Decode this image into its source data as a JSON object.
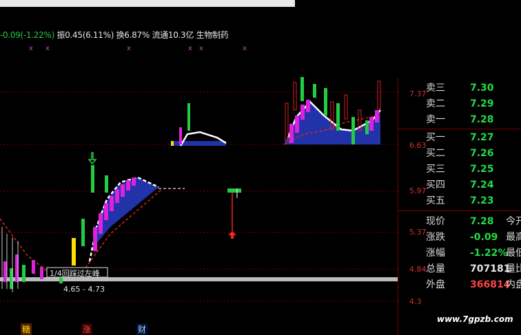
{
  "header": {
    "change": "-0.09(-1.22%)",
    "amplitude": "振0.45(6.11%)",
    "turnover": "换6.87%",
    "float_cap": "流通10.3亿",
    "name": "生物制药"
  },
  "price_axis": [
    "7.37",
    "6.63",
    "5.97",
    "5.37",
    "4.84",
    "4.3"
  ],
  "annotations": {
    "box_label": "1/4回踩过左峰",
    "range_label": "4.65 - 4.73"
  },
  "order_book": [
    {
      "label": "卖三",
      "value": "7.30",
      "color": "#22dd44"
    },
    {
      "label": "卖二",
      "value": "7.29",
      "color": "#22dd44"
    },
    {
      "label": "卖一",
      "value": "7.28",
      "color": "#22dd44"
    },
    {
      "label": "买一",
      "value": "7.27",
      "color": "#22dd44"
    },
    {
      "label": "买二",
      "value": "7.26",
      "color": "#22dd44"
    },
    {
      "label": "买三",
      "value": "7.25",
      "color": "#22dd44"
    },
    {
      "label": "买四",
      "value": "7.24",
      "color": "#22dd44"
    },
    {
      "label": "买五",
      "value": "7.23",
      "color": "#22dd44"
    }
  ],
  "quote": [
    {
      "label": "现价",
      "value": "7.28",
      "color": "#22dd44",
      "right": "今开"
    },
    {
      "label": "涨跌",
      "value": "-0.09",
      "color": "#22dd44",
      "right": "最高"
    },
    {
      "label": "涨幅",
      "value": "-1.22%",
      "color": "#22dd44",
      "right": "最低"
    },
    {
      "label": "总量",
      "value": "707181",
      "color": "#e6e6e6",
      "right": "量比"
    },
    {
      "label": "外盘",
      "value": "366814",
      "color": "#ff4444",
      "right": "内盘"
    }
  ],
  "bottom_flags": [
    "糖",
    "涨",
    "财"
  ],
  "watermark": "www.7gpzb.com"
}
